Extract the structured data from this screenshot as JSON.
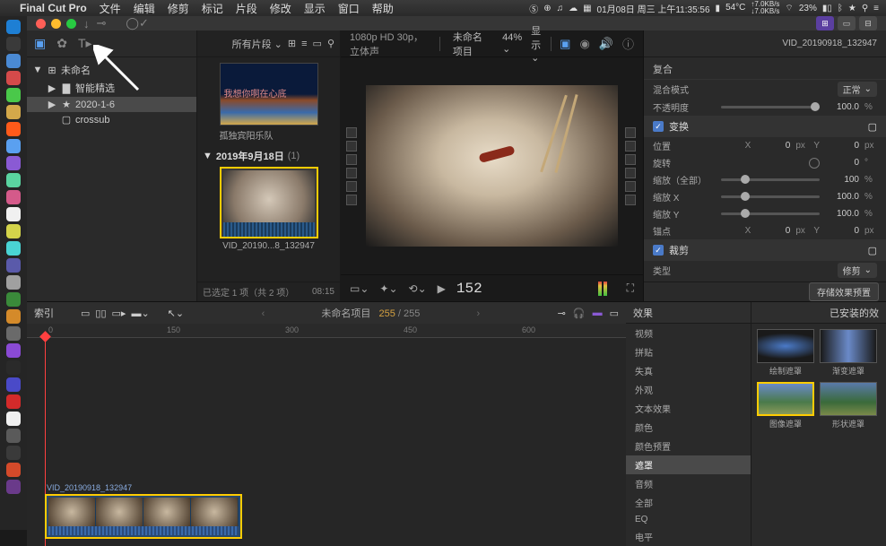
{
  "menubar": {
    "app": "Final Cut Pro",
    "items": [
      "文件",
      "编辑",
      "修剪",
      "标记",
      "片段",
      "修改",
      "显示",
      "窗口",
      "帮助"
    ],
    "date": "01月08日 周三 上午11:35:56",
    "net_up": "7.0KB/s",
    "net_down": "7.0KB/s",
    "temp": "54°C",
    "battery": "23%"
  },
  "library": {
    "root": "未命名",
    "items": [
      {
        "label": "智能精选",
        "icon": "folder"
      },
      {
        "label": "2020-1-6",
        "icon": "event"
      },
      {
        "label": "crossub",
        "icon": "event"
      }
    ]
  },
  "browser": {
    "filter": "所有片段",
    "item1_name": "孤独宾阳乐队",
    "item1_text": "我想你啊在心底",
    "date_header": "2019年9月18日",
    "date_count": "(1)",
    "item2_name": "VID_20190...8_132947",
    "footer_sel": "已选定 1 项（共 2 项）",
    "footer_dur": "08:15"
  },
  "viewer": {
    "format": "1080p HD 30p，立体声",
    "project": "未命名项目",
    "zoom": "44%",
    "view": "显示",
    "timecode": "152"
  },
  "inspector": {
    "clip_name": "VID_20190918_132947",
    "sections": {
      "composite": "复合",
      "blend_mode_lbl": "混合模式",
      "blend_mode_val": "正常",
      "opacity_lbl": "不透明度",
      "opacity_val": "100.0",
      "opacity_unit": "%",
      "transform": "变换",
      "position_lbl": "位置",
      "pos_x": "0",
      "pos_y": "0",
      "px": "px",
      "rotation_lbl": "旋转",
      "rot_val": "0",
      "rot_unit": "°",
      "scale_all_lbl": "缩放（全部）",
      "scale_all_val": "100",
      "pct": "%",
      "scale_x_lbl": "缩放 X",
      "scale_x_val": "100.0",
      "scale_y_lbl": "缩放 Y",
      "scale_y_val": "100.0",
      "anchor_lbl": "锚点",
      "anchor_x": "0",
      "anchor_y": "0",
      "crop": "裁剪",
      "crop_type_lbl": "类型",
      "crop_type_val": "修剪"
    },
    "save_btn": "存储效果预置"
  },
  "timeline": {
    "index_label": "索引",
    "project": "未命名项目",
    "count_a": "255",
    "count_b": "255",
    "ruler": [
      "0",
      "150",
      "300",
      "450",
      "600"
    ],
    "clip_name": "VID_20190918_132947"
  },
  "effects": {
    "header": "效果",
    "installed": "已安装的效",
    "cats": [
      "视频",
      "拼贴",
      "失真",
      "外观",
      "文本效果",
      "颜色",
      "颜色预置",
      "遮罩",
      "音频",
      "全部",
      "EQ",
      "电平"
    ],
    "cat_sel_index": 7,
    "items": [
      {
        "label": "绘制遮罩"
      },
      {
        "label": "渐变遮罩"
      },
      {
        "label": "图像遮罩"
      },
      {
        "label": "形状遮罩"
      }
    ]
  }
}
